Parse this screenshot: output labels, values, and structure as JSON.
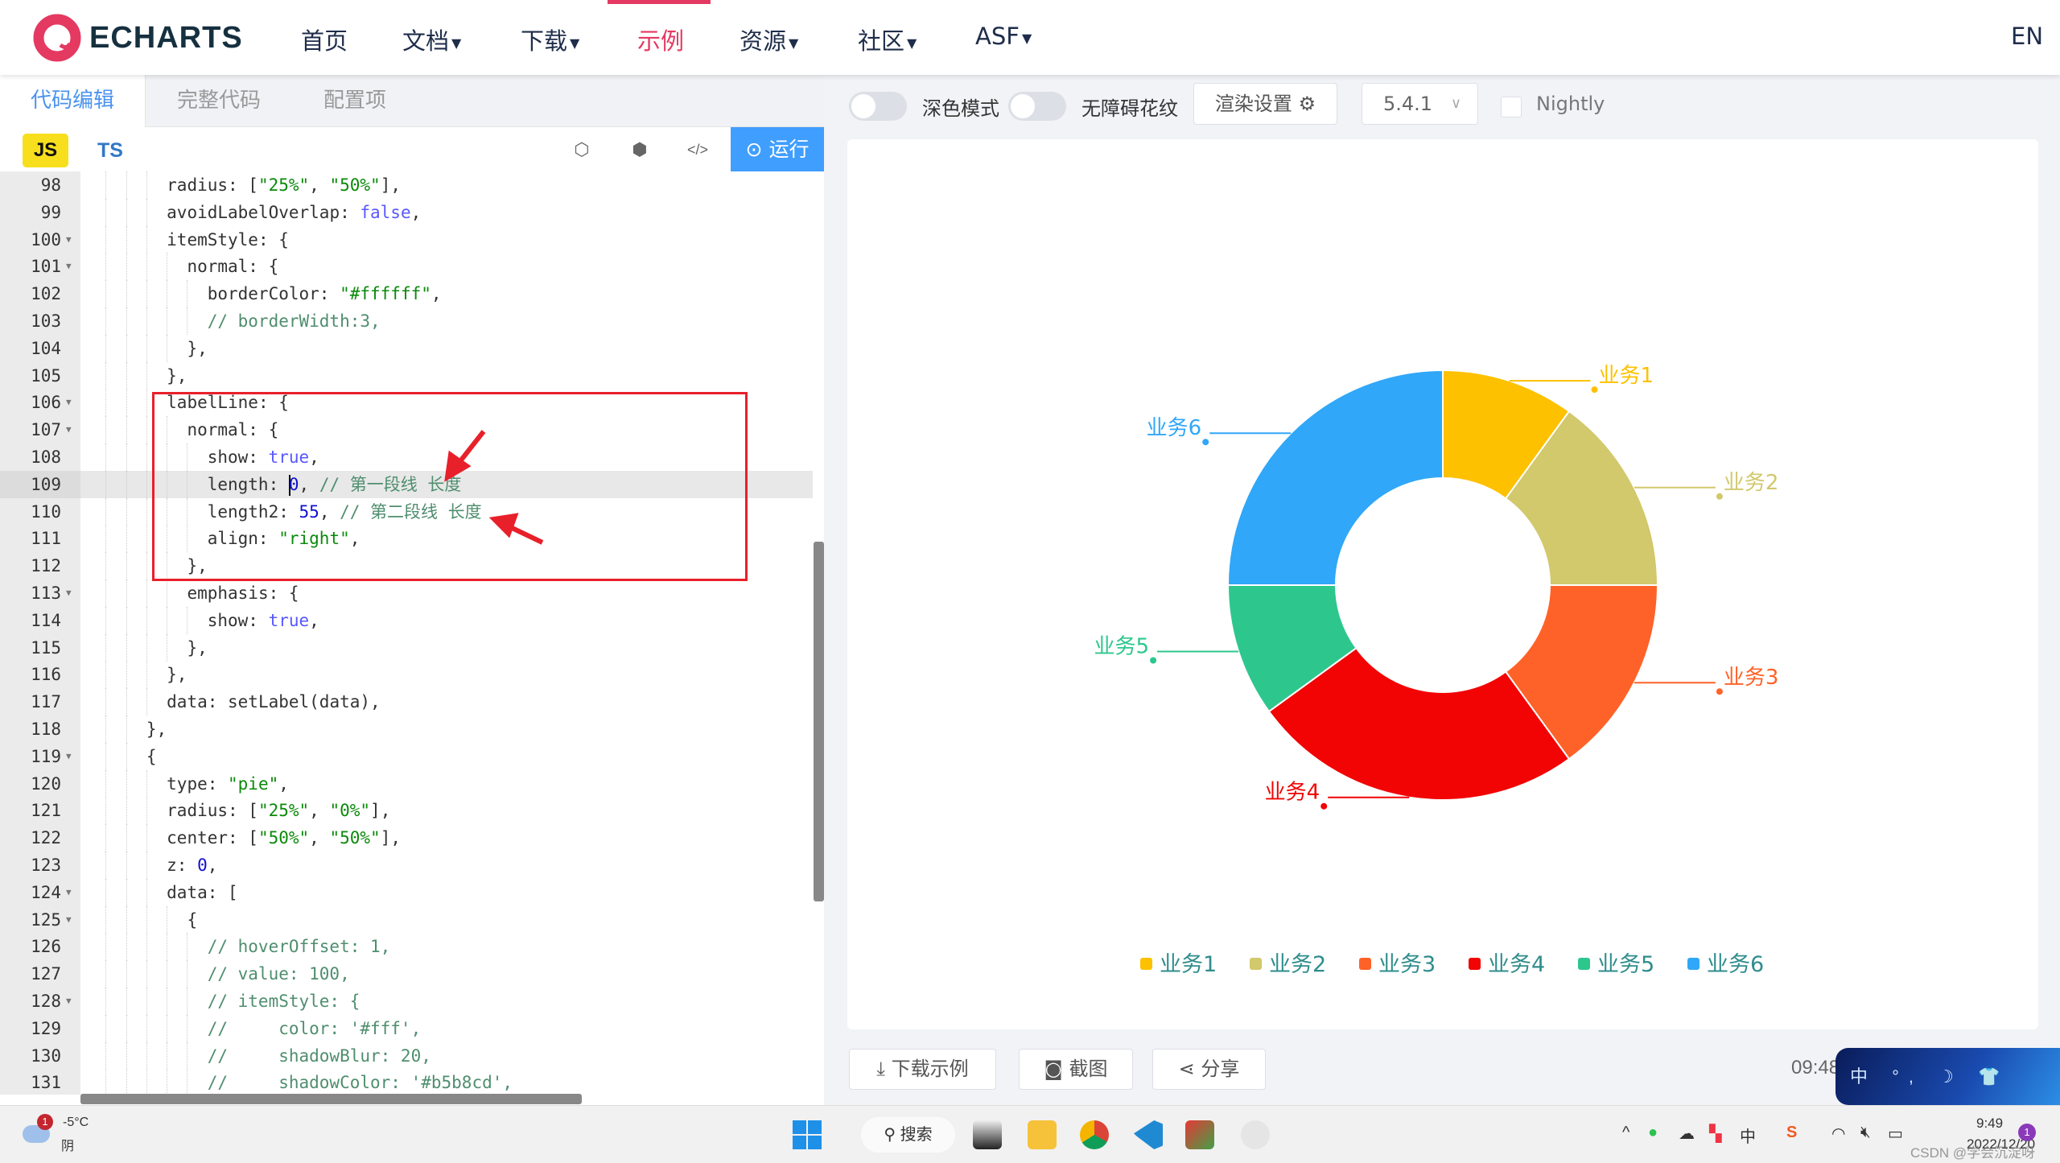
{
  "nav": {
    "logo_text": "ECHARTS",
    "items": [
      "首页",
      "文档",
      "下载",
      "示例",
      "资源",
      "社区",
      "ASF"
    ],
    "dropdown_flags": [
      false,
      true,
      true,
      false,
      true,
      true,
      true
    ],
    "active": "示例",
    "lang": "EN"
  },
  "editor": {
    "tabs": [
      "代码编辑",
      "完整代码",
      "配置项"
    ],
    "active_tab": "代码编辑",
    "lang_js": "JS",
    "lang_ts": "TS",
    "run_label": "运行",
    "cursor_line": 109,
    "lines": [
      {
        "n": 98,
        "indent": 8,
        "t": [
          [
            "p",
            "radius: ["
          ],
          [
            "s",
            "\"25%\""
          ],
          [
            "p",
            ", "
          ],
          [
            "s",
            "\"50%\""
          ],
          [
            "p",
            "],"
          ]
        ]
      },
      {
        "n": 99,
        "indent": 8,
        "t": [
          [
            "p",
            "avoidLabelOverlap: "
          ],
          [
            "k",
            "false"
          ],
          [
            "p",
            ","
          ]
        ]
      },
      {
        "n": 100,
        "indent": 8,
        "fold": true,
        "t": [
          [
            "p",
            "itemStyle: {"
          ]
        ]
      },
      {
        "n": 101,
        "indent": 10,
        "fold": true,
        "t": [
          [
            "p",
            "normal: {"
          ]
        ]
      },
      {
        "n": 102,
        "indent": 12,
        "t": [
          [
            "p",
            "borderColor: "
          ],
          [
            "s",
            "\"#ffffff\""
          ],
          [
            "p",
            ","
          ]
        ]
      },
      {
        "n": 103,
        "indent": 12,
        "t": [
          [
            "c",
            "// borderWidth:3,"
          ]
        ]
      },
      {
        "n": 104,
        "indent": 10,
        "t": [
          [
            "p",
            "},"
          ]
        ]
      },
      {
        "n": 105,
        "indent": 8,
        "t": [
          [
            "p",
            "},"
          ]
        ]
      },
      {
        "n": 106,
        "indent": 8,
        "fold": true,
        "t": [
          [
            "p",
            "labelLine: {"
          ]
        ]
      },
      {
        "n": 107,
        "indent": 10,
        "fold": true,
        "t": [
          [
            "p",
            "normal: {"
          ]
        ]
      },
      {
        "n": 108,
        "indent": 12,
        "t": [
          [
            "p",
            "show: "
          ],
          [
            "k",
            "true"
          ],
          [
            "p",
            ","
          ]
        ]
      },
      {
        "n": 109,
        "indent": 12,
        "t": [
          [
            "p",
            "length: "
          ],
          [
            "n",
            "0"
          ],
          [
            "p",
            ", "
          ],
          [
            "c",
            "// 第一段线 长度"
          ]
        ]
      },
      {
        "n": 110,
        "indent": 12,
        "t": [
          [
            "p",
            "length2: "
          ],
          [
            "n",
            "55"
          ],
          [
            "p",
            ", "
          ],
          [
            "c",
            "// 第二段线 长度"
          ]
        ]
      },
      {
        "n": 111,
        "indent": 12,
        "t": [
          [
            "p",
            "align: "
          ],
          [
            "s",
            "\"right\""
          ],
          [
            "p",
            ","
          ]
        ]
      },
      {
        "n": 112,
        "indent": 10,
        "t": [
          [
            "p",
            "},"
          ]
        ]
      },
      {
        "n": 113,
        "indent": 10,
        "fold": true,
        "t": [
          [
            "p",
            "emphasis: {"
          ]
        ]
      },
      {
        "n": 114,
        "indent": 12,
        "t": [
          [
            "p",
            "show: "
          ],
          [
            "k",
            "true"
          ],
          [
            "p",
            ","
          ]
        ]
      },
      {
        "n": 115,
        "indent": 10,
        "t": [
          [
            "p",
            "},"
          ]
        ]
      },
      {
        "n": 116,
        "indent": 8,
        "t": [
          [
            "p",
            "},"
          ]
        ]
      },
      {
        "n": 117,
        "indent": 8,
        "t": [
          [
            "p",
            "data: setLabel(data),"
          ]
        ]
      },
      {
        "n": 118,
        "indent": 6,
        "t": [
          [
            "p",
            "},"
          ]
        ]
      },
      {
        "n": 119,
        "indent": 6,
        "fold": true,
        "t": [
          [
            "p",
            "{"
          ]
        ]
      },
      {
        "n": 120,
        "indent": 8,
        "t": [
          [
            "p",
            "type: "
          ],
          [
            "s",
            "\"pie\""
          ],
          [
            "p",
            ","
          ]
        ]
      },
      {
        "n": 121,
        "indent": 8,
        "t": [
          [
            "p",
            "radius: ["
          ],
          [
            "s",
            "\"25%\""
          ],
          [
            "p",
            ", "
          ],
          [
            "s",
            "\"0%\""
          ],
          [
            "p",
            "],"
          ]
        ]
      },
      {
        "n": 122,
        "indent": 8,
        "t": [
          [
            "p",
            "center: ["
          ],
          [
            "s",
            "\"50%\""
          ],
          [
            "p",
            ", "
          ],
          [
            "s",
            "\"50%\""
          ],
          [
            "p",
            "],"
          ]
        ]
      },
      {
        "n": 123,
        "indent": 8,
        "t": [
          [
            "p",
            "z: "
          ],
          [
            "n",
            "0"
          ],
          [
            "p",
            ","
          ]
        ]
      },
      {
        "n": 124,
        "indent": 8,
        "fold": true,
        "t": [
          [
            "p",
            "data: ["
          ]
        ]
      },
      {
        "n": 125,
        "indent": 10,
        "fold": true,
        "t": [
          [
            "p",
            "{"
          ]
        ]
      },
      {
        "n": 126,
        "indent": 12,
        "t": [
          [
            "c",
            "// hoverOffset: 1,"
          ]
        ]
      },
      {
        "n": 127,
        "indent": 12,
        "t": [
          [
            "c",
            "// value: 100,"
          ]
        ]
      },
      {
        "n": 128,
        "indent": 12,
        "fold": true,
        "t": [
          [
            "c",
            "// itemStyle: {"
          ]
        ]
      },
      {
        "n": 129,
        "indent": 12,
        "t": [
          [
            "c",
            "//     color: '#fff',"
          ]
        ]
      },
      {
        "n": 130,
        "indent": 12,
        "t": [
          [
            "c",
            "//     shadowBlur: 20,"
          ]
        ]
      },
      {
        "n": 131,
        "indent": 12,
        "t": [
          [
            "c",
            "//     shadowColor: '#b5b8cd',"
          ]
        ]
      }
    ]
  },
  "toolbar": {
    "dark_mode": "深色模式",
    "dark_mode_on": false,
    "decal": "无障碍花纹",
    "decal_on": false,
    "render_settings": "渲染设置",
    "version": "5.4.1",
    "nightly": "Nightly",
    "nightly_checked": false
  },
  "actions": {
    "download": "下载示例",
    "screenshot": "截图",
    "share": "分享",
    "time": "09:48"
  },
  "ime": "中 °, ☽ 👕",
  "taskbar": {
    "weather_temp": "-5°C",
    "weather_desc": "阴",
    "weather_badge": "1",
    "search": "搜索",
    "ime_lang": "中",
    "clock_time": "9:49",
    "clock_date": "2022/12/20",
    "notif_count": "1",
    "watermark": "CSDN @学会沉淀呀"
  },
  "chart_data": {
    "type": "pie",
    "donut": true,
    "categories": [
      "业务1",
      "业务2",
      "业务3",
      "业务4",
      "业务5",
      "业务6"
    ],
    "values": [
      10,
      15,
      15,
      25,
      10,
      25
    ],
    "colors": [
      "#fdc100",
      "#d2c86c",
      "#ff6228",
      "#f20404",
      "#2dc78e",
      "#30a7f8"
    ],
    "radius": [
      "25%",
      "50%"
    ],
    "legend_position": "bottom",
    "legend_text_color": "#2f8d8c"
  }
}
